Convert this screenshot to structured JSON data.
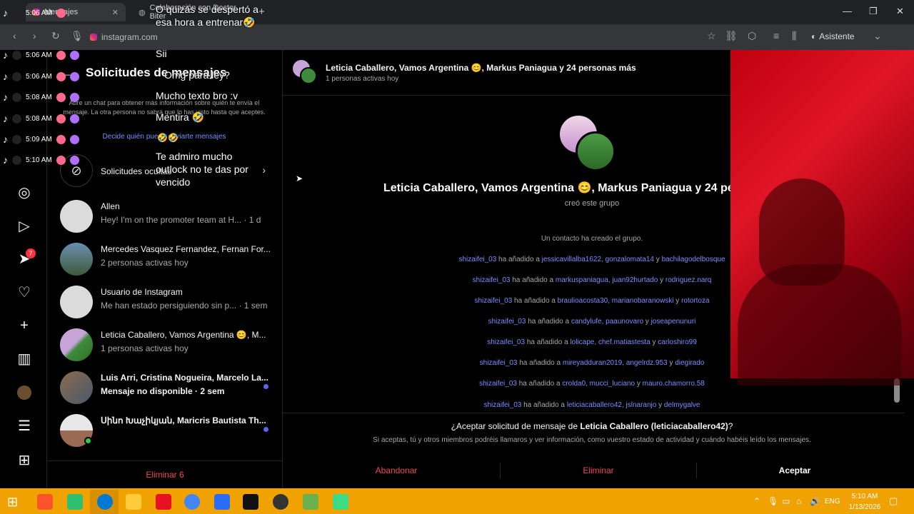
{
  "browser": {
    "tabs": [
      {
        "label": "Mensajes"
      },
      {
        "label": "Colaboración con Doctor Biter"
      }
    ],
    "url": "instagram.com",
    "assistant_label": "Asistente"
  },
  "rail": {
    "notif_badge": "7"
  },
  "requests_panel": {
    "title": "Solicitudes de mensajes",
    "info_text": "Abre un chat para obtener más información sobre quién te envía el mensaje. La otra persona no sabrá que lo has visto hasta que aceptes.",
    "link_text": "Decide quién puede enviarte mensajes",
    "hidden_label": "Solicitudes ocultas",
    "rows": [
      {
        "name": "Allen",
        "sub": "Hey! I'm on the promoter team at H... · 1 d"
      },
      {
        "name": "Mercedes Vasquez Fernandez, Fernan For...",
        "sub": "2 personas activas hoy"
      },
      {
        "name": "Usuario de Instagram",
        "sub": "Me han estado persiguiendo sin p... · 1 sem"
      },
      {
        "name": "Leticia Caballero, Vamos Argentina 😊, M...",
        "sub": "1 personas activas hoy"
      },
      {
        "name": "Luis Arri, Cristina Nogueira, Marcelo La...",
        "sub": "Mensaje no disponible · 2 sem"
      },
      {
        "name": "Սինո Խաչիկյան, Maricris Bautista Th...",
        "sub": ""
      }
    ],
    "delete_label": "Eliminar 6"
  },
  "conversation": {
    "header_title": "Leticia Caballero, Vamos Argentina 😊, Markus Paniagua y 24 personas más",
    "header_sub": "1 personas activas hoy",
    "group_title": "Leticia Caballero, Vamos Argentina 😊, Markus Paniagua y 24 pe",
    "created_label": "creó este grupo",
    "contact_created": "Un contacto ha creado el grupo.",
    "lines": [
      {
        "actor": "shizaifei_03",
        "verb": " ha añadido a ",
        "users": "jessicavillalba1622, gonzalomata14",
        "conj": " y ",
        "last": "bachilagodelbosque"
      },
      {
        "actor": "shizaifei_03",
        "verb": " ha añadido a ",
        "users": "markuspaniagua, juan92hurtado",
        "conj": " y ",
        "last": "rodriguez.narq"
      },
      {
        "actor": "shizaifei_03",
        "verb": " ha añadido a ",
        "users": "braulioacosta30, marianobaranowski",
        "conj": " y ",
        "last": "rotortoza"
      },
      {
        "actor": "shizaifei_03",
        "verb": " ha añadido a ",
        "users": "candylufe, paaunovaro",
        "conj": " y ",
        "last": "joseapenunuri"
      },
      {
        "actor": "shizaifei_03",
        "verb": " ha añadido a ",
        "users": "lolicape, chef.matiastesta",
        "conj": " y ",
        "last": "carloshiro99"
      },
      {
        "actor": "shizaifei_03",
        "verb": " ha añadido a ",
        "users": "mireyadduran2019, angelrdz.953",
        "conj": " y ",
        "last": "diegirado"
      },
      {
        "actor": "shizaifei_03",
        "verb": " ha añadido a ",
        "users": "crolda0, mucci_luciano",
        "conj": " y ",
        "last": "mauro.chamorro.58"
      },
      {
        "actor": "shizaifei_03",
        "verb": " ha añadido a ",
        "users": "leticiacaballero42, jslnaranjo",
        "conj": " y ",
        "last": "delmygalve"
      }
    ],
    "accept_question_pre": "¿Aceptar solicitud de mensaje de ",
    "accept_question_name": "Leticia Caballero (leticiacaballero42)",
    "accept_question_post": "?",
    "accept_info": "Si aceptas, tú y otros miembros podréis llamaros y ver información, como vuestro estado de actividad y cuándo habéis leído los mensajes.",
    "btn_leave": "Abandonar",
    "btn_delete": "Eliminar",
    "btn_accept": "Aceptar"
  },
  "tiktok_overlay": {
    "times": [
      "5:06 AM",
      "5:06 AM",
      "5:06 AM",
      "5:08 AM",
      "5:08 AM",
      "5:09 AM",
      "5:10 AM"
    ],
    "messages": [
      "O quizás se despertó a esa hora a entrenar🤣",
      "Sii",
      "Omg para ley?",
      "Mucho texto bro :v",
      "Mentira 🤣",
      "🤣🤣",
      "Te admiro mucho outlock no te das por vencido"
    ]
  },
  "taskbar": {
    "lang": "ENG",
    "time": "5:10 AM",
    "date": "1/13/2026"
  }
}
